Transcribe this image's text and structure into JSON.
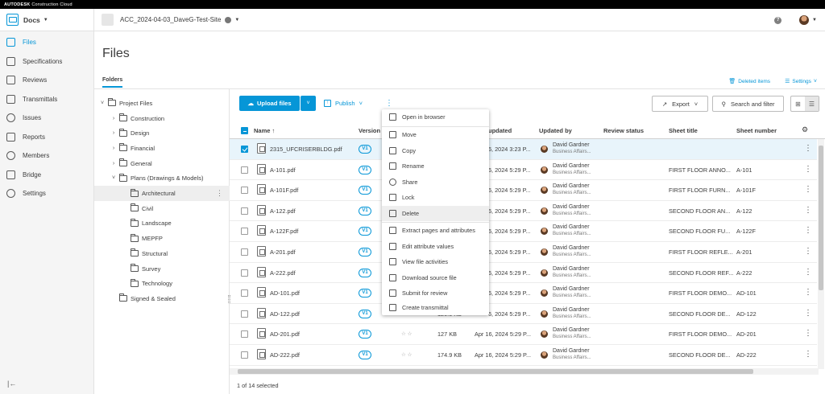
{
  "topbar": {
    "brand": "AUTODESK",
    "product": "Construction Cloud"
  },
  "appbar": {
    "module": "Docs",
    "project": "ACC_2024-04-03_DaveG-Test-Site",
    "help": "?"
  },
  "sidebar": {
    "items": [
      {
        "label": "Files",
        "icon": "folder-icon",
        "active": true
      },
      {
        "label": "Specifications",
        "icon": "spec-icon"
      },
      {
        "label": "Reviews",
        "icon": "review-icon"
      },
      {
        "label": "Transmittals",
        "icon": "transmittal-icon"
      },
      {
        "label": "Issues",
        "icon": "issue-icon"
      },
      {
        "label": "Reports",
        "icon": "report-icon"
      },
      {
        "label": "Members",
        "icon": "members-icon"
      },
      {
        "label": "Bridge",
        "icon": "bridge-icon"
      },
      {
        "label": "Settings",
        "icon": "gear-icon"
      }
    ],
    "collapse": "|←"
  },
  "page": {
    "title": "Files",
    "tab": "Folders",
    "deleted_items": "Deleted items",
    "settings": "Settings"
  },
  "tree": [
    {
      "label": "Project Files",
      "chevron": "˅"
    },
    {
      "label": "Construction",
      "chevron": "›"
    },
    {
      "label": "Design",
      "chevron": "›"
    },
    {
      "label": "Financial",
      "chevron": "›"
    },
    {
      "label": "General",
      "chevron": "›"
    },
    {
      "label": "Plans (Drawings & Models)",
      "chevron": "˅"
    },
    {
      "label": "Architectural",
      "chevron": ""
    },
    {
      "label": "Civil",
      "chevron": ""
    },
    {
      "label": "Landscape",
      "chevron": ""
    },
    {
      "label": "MEPFP",
      "chevron": ""
    },
    {
      "label": "Structural",
      "chevron": ""
    },
    {
      "label": "Survey",
      "chevron": ""
    },
    {
      "label": "Technology",
      "chevron": ""
    },
    {
      "label": "Signed & Sealed",
      "chevron": ""
    }
  ],
  "toolbar": {
    "upload": "Upload files",
    "publish": "Publish",
    "more": "⋮",
    "export": "Export",
    "search": "Search and filter"
  },
  "table": {
    "headers": {
      "name": "Name ↑",
      "version": "Version",
      "updated": "updated",
      "updated_by": "Updated by",
      "review_status": "Review status",
      "sheet_title": "Sheet title",
      "sheet_number": "Sheet number"
    },
    "rows": [
      {
        "name": "2315_UFCRISERBLDG.pdf",
        "version": "V1",
        "size": "",
        "updated": "6, 2024 3:23 P...",
        "user": "David Gardner",
        "company": "Business Affairs...",
        "sheet_title": "",
        "sheet_number": "",
        "selected": true
      },
      {
        "name": "A-101.pdf",
        "version": "V1",
        "size": "",
        "updated": "6, 2024 5:29 P...",
        "user": "David Gardner",
        "company": "Business Affairs...",
        "sheet_title": "FIRST FLOOR ANNO...",
        "sheet_number": "A-101"
      },
      {
        "name": "A-101F.pdf",
        "version": "V1",
        "size": "",
        "updated": "6, 2024 5:29 P...",
        "user": "David Gardner",
        "company": "Business Affairs...",
        "sheet_title": "FIRST FLOOR FURN...",
        "sheet_number": "A-101F"
      },
      {
        "name": "A-122.pdf",
        "version": "V1",
        "size": "",
        "updated": "6, 2024 5:29 P...",
        "user": "David Gardner",
        "company": "Business Affairs...",
        "sheet_title": "SECOND FLOOR AN...",
        "sheet_number": "A-122"
      },
      {
        "name": "A-122F.pdf",
        "version": "V1",
        "size": "",
        "updated": "6, 2024 5:29 P...",
        "user": "David Gardner",
        "company": "Business Affairs...",
        "sheet_title": "SECOND FLOOR FU...",
        "sheet_number": "A-122F"
      },
      {
        "name": "A-201.pdf",
        "version": "V1",
        "size": "",
        "updated": "6, 2024 5:29 P...",
        "user": "David Gardner",
        "company": "Business Affairs...",
        "sheet_title": "FIRST FLOOR REFLE...",
        "sheet_number": "A-201"
      },
      {
        "name": "A-222.pdf",
        "version": "V1",
        "size": "",
        "updated": "6, 2024 5:29 P...",
        "user": "David Gardner",
        "company": "Business Affairs...",
        "sheet_title": "SECOND FLOOR REF...",
        "sheet_number": "A-222"
      },
      {
        "name": "AD-101.pdf",
        "version": "V1",
        "size": "",
        "updated": "6, 2024 5:29 P...",
        "user": "David Gardner",
        "company": "Business Affairs...",
        "sheet_title": "FIRST FLOOR DEMO...",
        "sheet_number": "AD-101"
      },
      {
        "name": "AD-122.pdf",
        "version": "V1",
        "size": "120.5 KB",
        "updated": "6, 2024 5:29 P...",
        "user": "David Gardner",
        "company": "Business Affairs...",
        "sheet_title": "SECOND FLOOR DE...",
        "sheet_number": "AD-122"
      },
      {
        "name": "AD-201.pdf",
        "version": "V1",
        "size": "127 KB",
        "updated": "Apr 16, 2024 5:29 P...",
        "user": "David Gardner",
        "company": "Business Affairs...",
        "sheet_title": "FIRST FLOOR DEMO...",
        "sheet_number": "AD-201"
      },
      {
        "name": "AD-222.pdf",
        "version": "V1",
        "size": "174.9 KB",
        "updated": "Apr 16, 2024 5:29 P...",
        "user": "David Gardner",
        "company": "Business Affairs...",
        "sheet_title": "SECOND FLOOR DE...",
        "sheet_number": "AD-222"
      }
    ]
  },
  "footer": {
    "selection": "1 of 14 selected"
  },
  "context_menu": {
    "items": [
      {
        "label": "Open in browser",
        "icon": "browser-icon"
      },
      {
        "label": "Move",
        "icon": "move-icon"
      },
      {
        "label": "Copy",
        "icon": "copy-icon"
      },
      {
        "label": "Rename",
        "icon": "pencil-icon"
      },
      {
        "label": "Share",
        "icon": "share-icon"
      },
      {
        "label": "Lock",
        "icon": "lock-icon"
      },
      {
        "label": "Delete",
        "icon": "trash-icon",
        "hover": true
      },
      {
        "label": "Extract pages and attributes",
        "icon": "extract-icon"
      },
      {
        "label": "Edit attribute values",
        "icon": "edit-icon"
      },
      {
        "label": "View file activities",
        "icon": "activity-icon"
      },
      {
        "label": "Download source file",
        "icon": "download-icon"
      },
      {
        "label": "Submit for review",
        "icon": "submit-review-icon"
      },
      {
        "label": "Create transmittal",
        "icon": "transmittal-icon"
      }
    ]
  },
  "colors": {
    "accent": "#0696d7",
    "selected_row": "#e8f4fb",
    "sidebar_bg": "#f5f5f5"
  }
}
